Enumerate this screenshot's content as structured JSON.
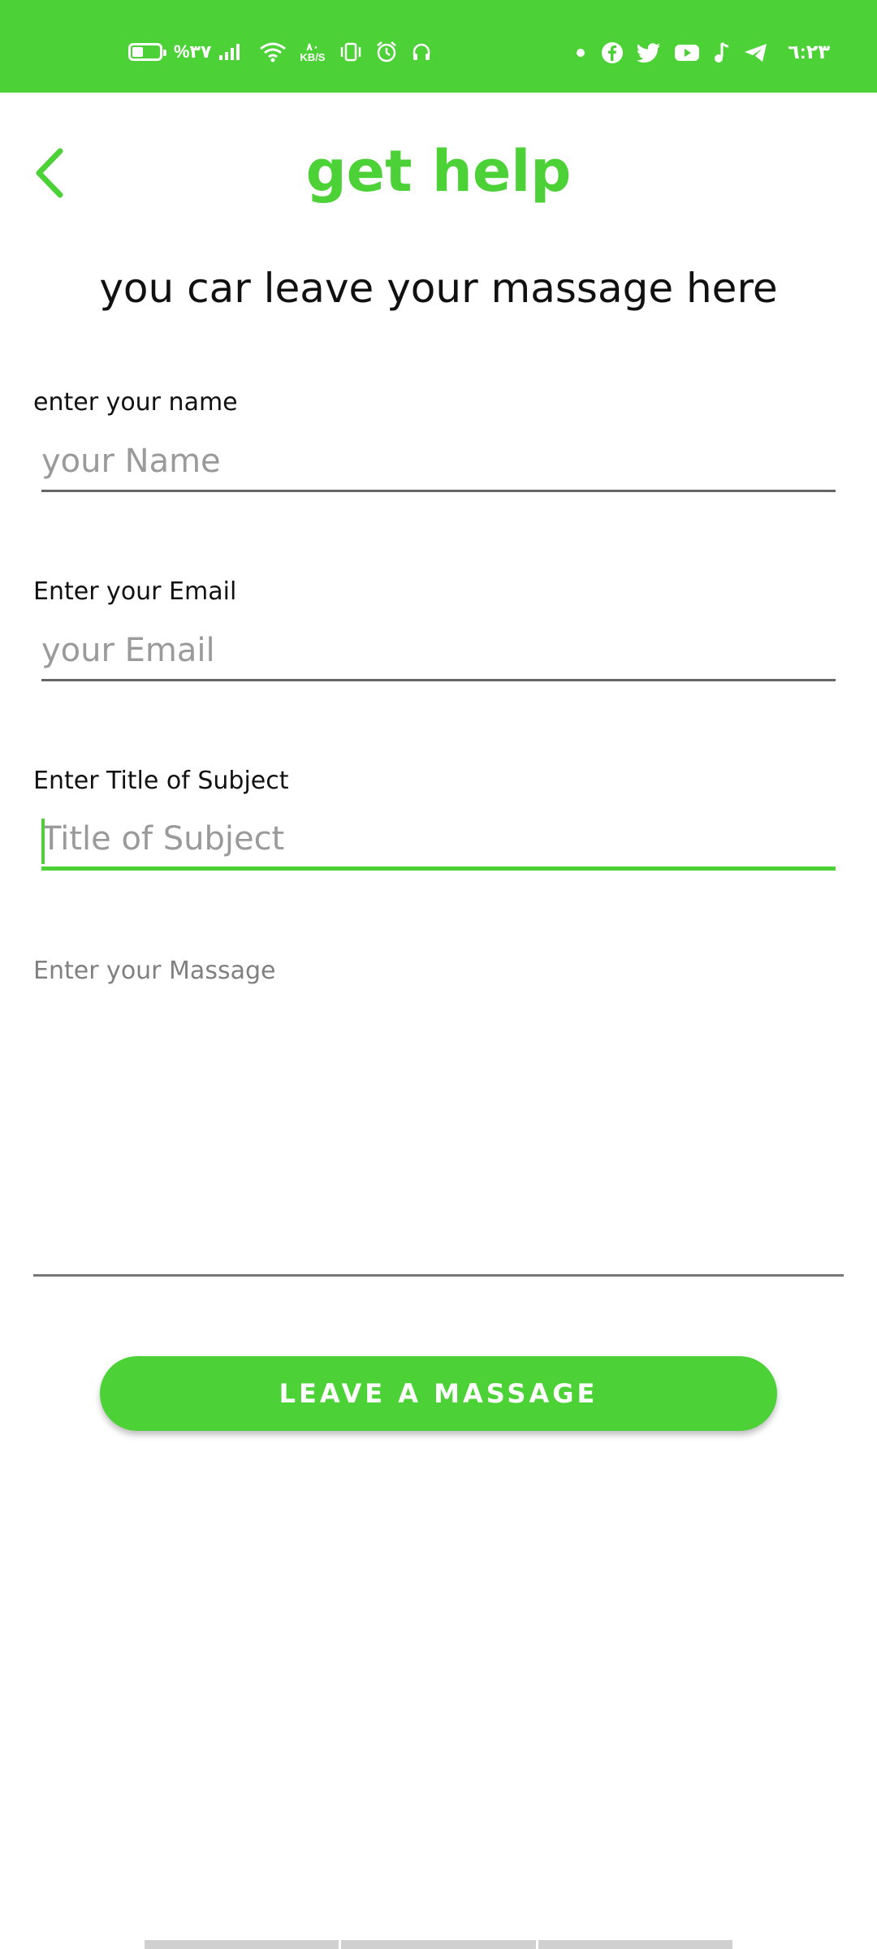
{
  "status_bar": {
    "battery_text": "%۳۷",
    "battery_level": 0.37,
    "net_speed_value": "۸٠",
    "net_speed_unit": "KB/S",
    "time": "٦:٢٣",
    "left_icons": [
      "battery-icon",
      "signal-icon",
      "wifi-icon",
      "vibrate-icon",
      "alarm-icon",
      "headphones-icon"
    ],
    "right_icons": [
      "notification-dot-icon",
      "facebook-icon",
      "twitter-icon",
      "youtube-icon",
      "music-icon",
      "telegram-icon"
    ]
  },
  "header": {
    "title": "get help",
    "back_icon": "chevron-left-icon"
  },
  "subtitle": "you car leave your massage here",
  "form": {
    "name": {
      "label": "enter your name",
      "placeholder": "your Name",
      "value": ""
    },
    "email": {
      "label": "Enter your Email",
      "placeholder": "your Email",
      "value": ""
    },
    "subject": {
      "label": "Enter Title of Subject",
      "placeholder": "Title of Subject",
      "value": "",
      "focused": true
    },
    "message": {
      "label": "Enter your Massage",
      "value": ""
    },
    "submit_label": "LEAVE A MASSAGE"
  },
  "colors": {
    "accent": "#4cd137",
    "text": "#111111",
    "placeholder": "#9a9a9a",
    "underline": "#666666"
  }
}
